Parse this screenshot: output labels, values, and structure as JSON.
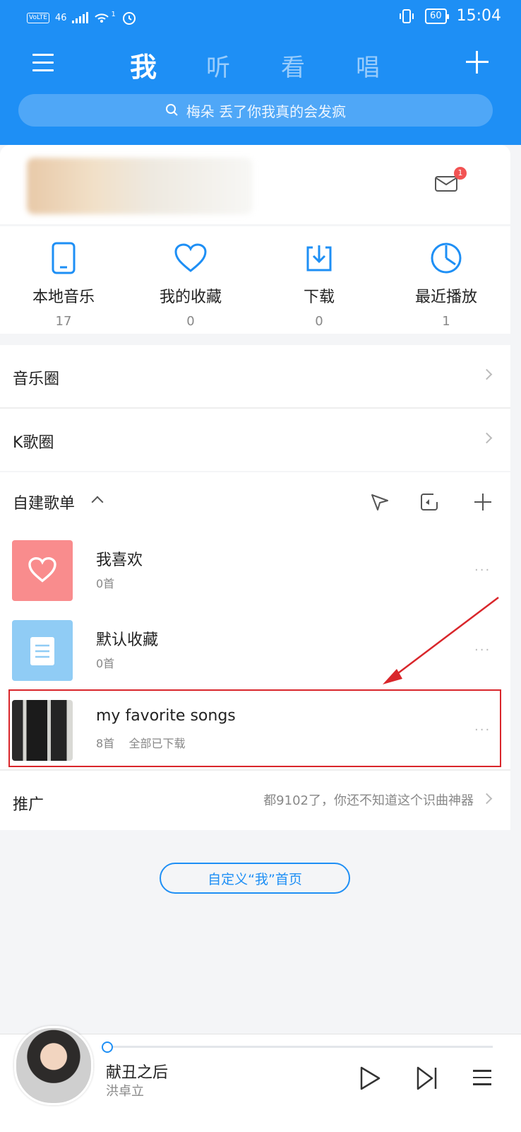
{
  "status": {
    "network": "46",
    "sim": "1",
    "battery": "60",
    "time": "15:04"
  },
  "nav": {
    "tabs": [
      {
        "label": "我"
      },
      {
        "label": "听"
      },
      {
        "label": "看"
      },
      {
        "label": "唱"
      }
    ]
  },
  "search": {
    "placeholder": "梅朵 丢了你我真的会发疯"
  },
  "profile": {
    "mail_badge": "1"
  },
  "quick": [
    {
      "label": "本地音乐",
      "count": "17",
      "icon": "phone-icon"
    },
    {
      "label": "我的收藏",
      "count": "0",
      "icon": "heart-icon"
    },
    {
      "label": "下载",
      "count": "0",
      "icon": "download-icon"
    },
    {
      "label": "最近播放",
      "count": "1",
      "icon": "clock-icon"
    }
  ],
  "rows": {
    "music_circle": "音乐圈",
    "k_circle": "K歌圈"
  },
  "playlists": {
    "header": "自建歌单",
    "items": [
      {
        "name": "我喜欢",
        "sub": "0首",
        "cover_color": "#F98C8D"
      },
      {
        "name": "默认收藏",
        "sub": "0首",
        "cover_color": "#90CCF5"
      },
      {
        "name": "my favorite songs",
        "sub": "8首",
        "status": "全部已下载"
      }
    ],
    "more": "···"
  },
  "promo": {
    "label": "推广",
    "text": "都9102了，你还不知道这个识曲神器"
  },
  "customize": "自定义“我”首页",
  "player": {
    "song": "献丑之后",
    "artist": "洪卓立"
  },
  "colors": {
    "brand": "#1E8FF5",
    "highlight": "#D9262B"
  }
}
